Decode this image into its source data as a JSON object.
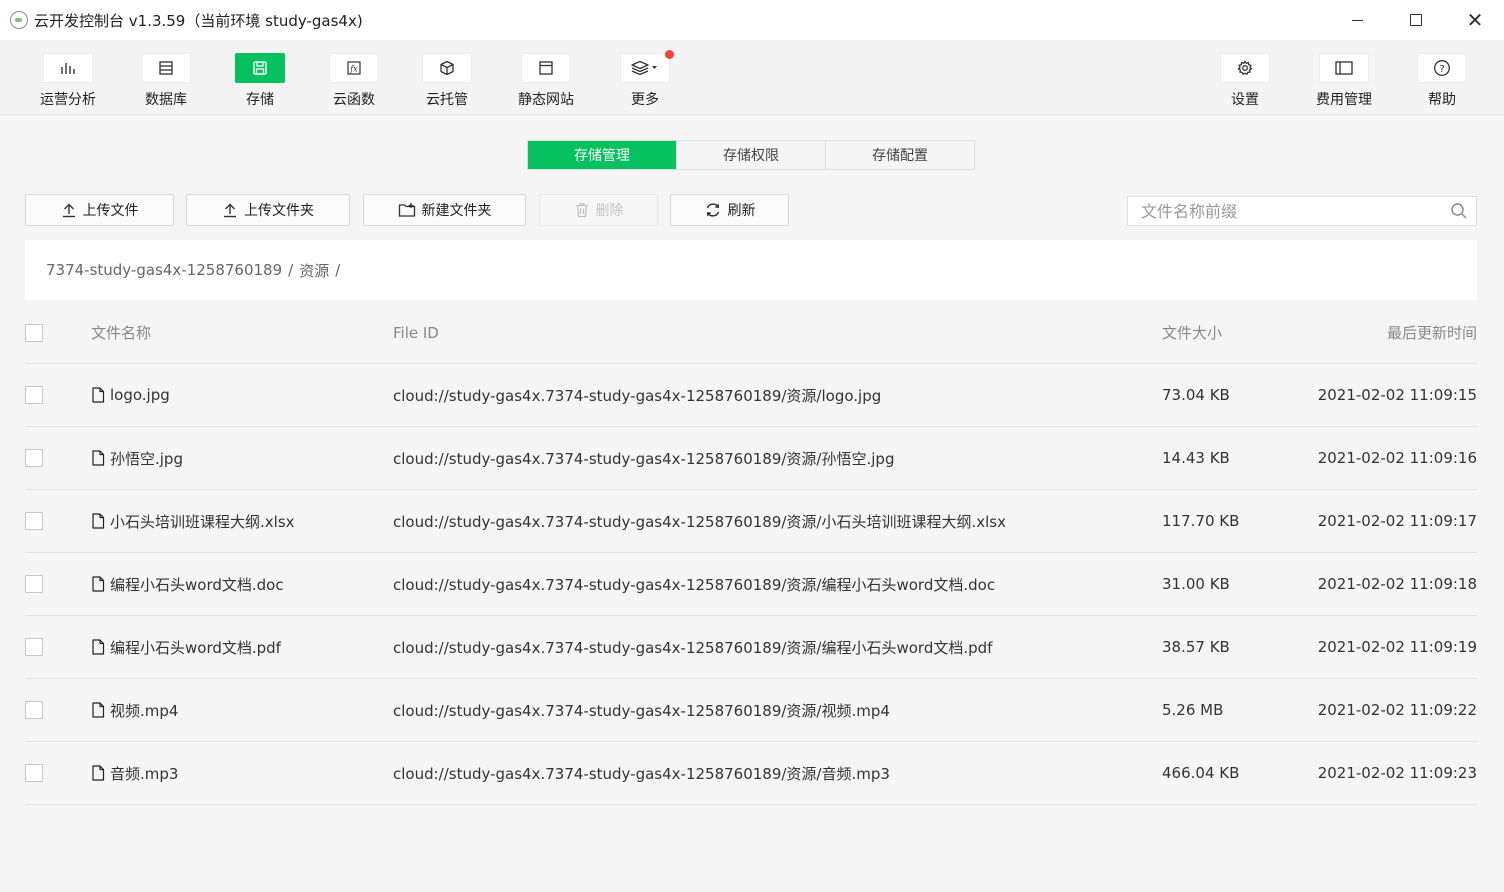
{
  "window": {
    "title": "云开发控制台 v1.3.59（当前环境 study-gas4x)"
  },
  "toolbar": {
    "items": [
      {
        "label": "运营分析",
        "icon": "bar-chart-icon"
      },
      {
        "label": "数据库",
        "icon": "database-icon"
      },
      {
        "label": "存储",
        "icon": "storage-icon",
        "active": true
      },
      {
        "label": "云函数",
        "icon": "function-icon"
      },
      {
        "label": "云托管",
        "icon": "cube-icon"
      },
      {
        "label": "静态网站",
        "icon": "browser-window-icon"
      },
      {
        "label": "更多",
        "icon": "layers-icon",
        "badge": true
      },
      {
        "label": "设置",
        "icon": "gear-icon"
      },
      {
        "label": "费用管理",
        "icon": "sidebar-panel-icon"
      },
      {
        "label": "帮助",
        "icon": "help-icon"
      }
    ]
  },
  "tabs": [
    {
      "label": "存储管理",
      "active": true
    },
    {
      "label": "存储权限"
    },
    {
      "label": "存储配置"
    }
  ],
  "actions": {
    "upload_file": "上传文件",
    "upload_folder": "上传文件夹",
    "new_folder": "新建文件夹",
    "delete": "删除",
    "refresh": "刷新"
  },
  "search": {
    "placeholder": "文件名称前缀"
  },
  "breadcrumb": {
    "bucket": "7374-study-gas4x-1258760189",
    "folder": "资源",
    "separator": "/"
  },
  "table": {
    "columns": {
      "name": "文件名称",
      "file_id": "File ID",
      "size": "文件大小",
      "updated": "最后更新时间"
    },
    "rows": [
      {
        "name": "logo.jpg",
        "file_id": "cloud://study-gas4x.7374-study-gas4x-1258760189/资源/logo.jpg",
        "size": "73.04 KB",
        "updated": "2021-02-02 11:09:15"
      },
      {
        "name": "孙悟空.jpg",
        "file_id": "cloud://study-gas4x.7374-study-gas4x-1258760189/资源/孙悟空.jpg",
        "size": "14.43 KB",
        "updated": "2021-02-02 11:09:16"
      },
      {
        "name": "小石头培训班课程大纲.xlsx",
        "file_id": "cloud://study-gas4x.7374-study-gas4x-1258760189/资源/小石头培训班课程大纲.xlsx",
        "size": "117.70 KB",
        "updated": "2021-02-02 11:09:17"
      },
      {
        "name": "编程小石头word文档.doc",
        "file_id": "cloud://study-gas4x.7374-study-gas4x-1258760189/资源/编程小石头word文档.doc",
        "size": "31.00 KB",
        "updated": "2021-02-02 11:09:18"
      },
      {
        "name": "编程小石头word文档.pdf",
        "file_id": "cloud://study-gas4x.7374-study-gas4x-1258760189/资源/编程小石头word文档.pdf",
        "size": "38.57 KB",
        "updated": "2021-02-02 11:09:19"
      },
      {
        "name": "视频.mp4",
        "file_id": "cloud://study-gas4x.7374-study-gas4x-1258760189/资源/视频.mp4",
        "size": "5.26 MB",
        "updated": "2021-02-02 11:09:22"
      },
      {
        "name": "音频.mp3",
        "file_id": "cloud://study-gas4x.7374-study-gas4x-1258760189/资源/音频.mp3",
        "size": "466.04 KB",
        "updated": "2021-02-02 11:09:23"
      }
    ]
  },
  "colors": {
    "accent": "#07c160",
    "badge": "#f0443c"
  }
}
